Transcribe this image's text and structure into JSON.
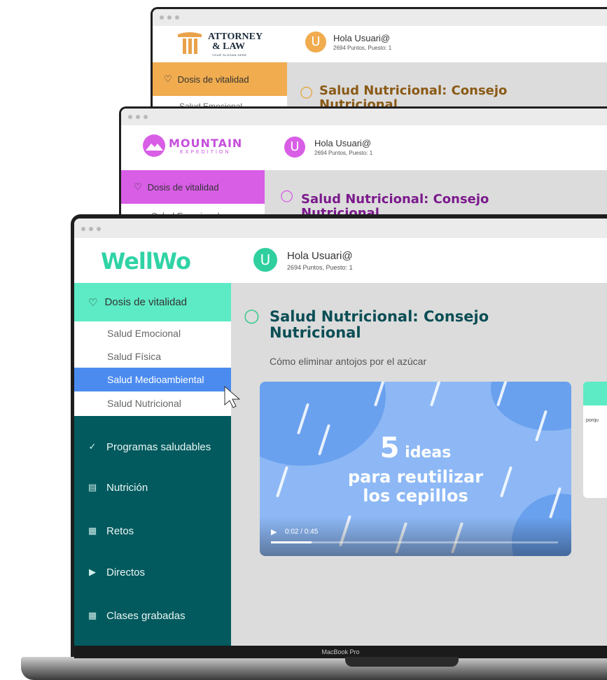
{
  "back_window": {
    "logo_line1": "ATTORNEY",
    "logo_line2": "& LAW",
    "logo_tagline": "YOUR SLOGAN HERE",
    "avatar_letter": "U",
    "greeting": "Hola Usuari@",
    "points": "2694 Puntos, Puesto: 1",
    "active_item": "Dosis de vitalidad",
    "sub_item": "Salud Emocional",
    "title": "Salud Nutricional: Consejo",
    "title_line2": "Nutricional",
    "accent": "#f0ac4f",
    "title_color": "#8a5a16"
  },
  "middle_window": {
    "logo_main": "MOUNTAIN",
    "logo_sub": "EXPEDITION",
    "avatar_letter": "U",
    "greeting": "Hola Usuari@",
    "points": "2694 Puntos, Puesto: 1",
    "active_item": "Dosis de vitalidad",
    "sub_item": "Salud Emocional",
    "title": "Salud Nutricional: Consejo",
    "title_line2": "Nutricional",
    "accent": "#d85ee6",
    "title_color": "#7b1a8c"
  },
  "main_window": {
    "logo": "WellWo",
    "avatar_letter": "U",
    "greeting": "Hola Usuari@",
    "points": "2694 Puntos, Puesto: 1",
    "sidebar": {
      "active_item": "Dosis de vitalidad",
      "sub_items": [
        "Salud Emocional",
        "Salud Física",
        "Salud Medioambiental",
        "Salud Nutricional"
      ],
      "selected_sub_item": "Salud Medioambiental",
      "nav_items": [
        {
          "label": "Programas saludables",
          "icon": "check-shield-icon"
        },
        {
          "label": "Nutrición",
          "icon": "clipboard-icon"
        },
        {
          "label": "Retos",
          "icon": "challenge-icon"
        },
        {
          "label": "Directos",
          "icon": "play-icon"
        },
        {
          "label": "Clases grabadas",
          "icon": "video-grid-icon"
        }
      ]
    },
    "content": {
      "title_line1": "Salud Nutricional: Consejo",
      "title_line2": "Nutricional",
      "subtitle": "Cómo eliminar antojos por el azúcar",
      "video": {
        "number": "5",
        "word": "ideas",
        "line2": "para reutilizar",
        "line3": "los cepillos",
        "time": "0:02 / 0:45",
        "progress": 0.044
      },
      "side_card_text": "porqu"
    },
    "accent": "#5cebc4",
    "selected_color": "#4b8bf0",
    "dark_color": "#035a5e",
    "title_color": "#0b4e55"
  },
  "device_label": "MacBook Pro"
}
